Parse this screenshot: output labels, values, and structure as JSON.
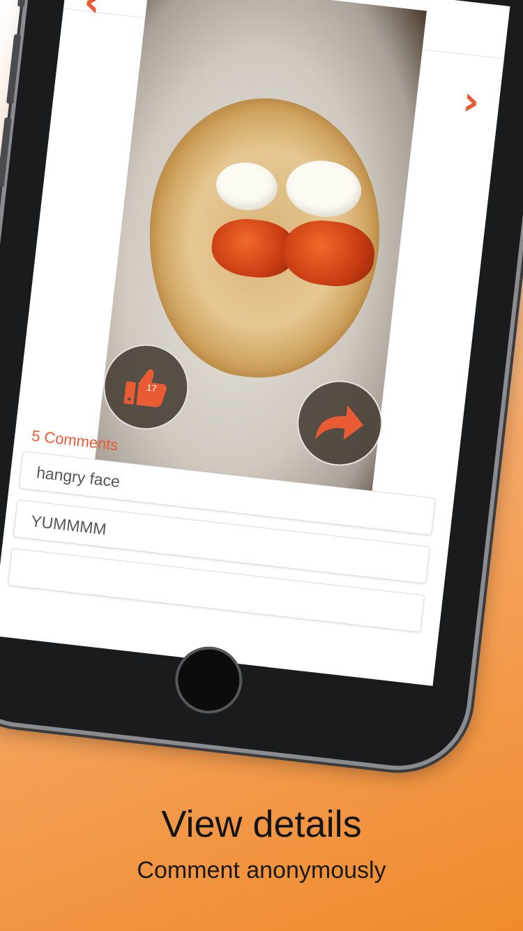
{
  "photo": {
    "like_count": "17"
  },
  "comments": {
    "title": "5 Comments",
    "items": [
      "hangry face",
      "YUMMMM",
      ""
    ]
  },
  "caption": {
    "title": "View details",
    "subtitle": "Comment anonymously"
  },
  "icons": {
    "prev": "chevron-left-icon",
    "next": "chevron-right-icon",
    "like": "thumbs-up-icon",
    "share": "share-arrow-icon"
  },
  "colors": {
    "accent": "#e95b33",
    "background_top": "#ffffff",
    "background_bottom": "#f08a2c"
  }
}
